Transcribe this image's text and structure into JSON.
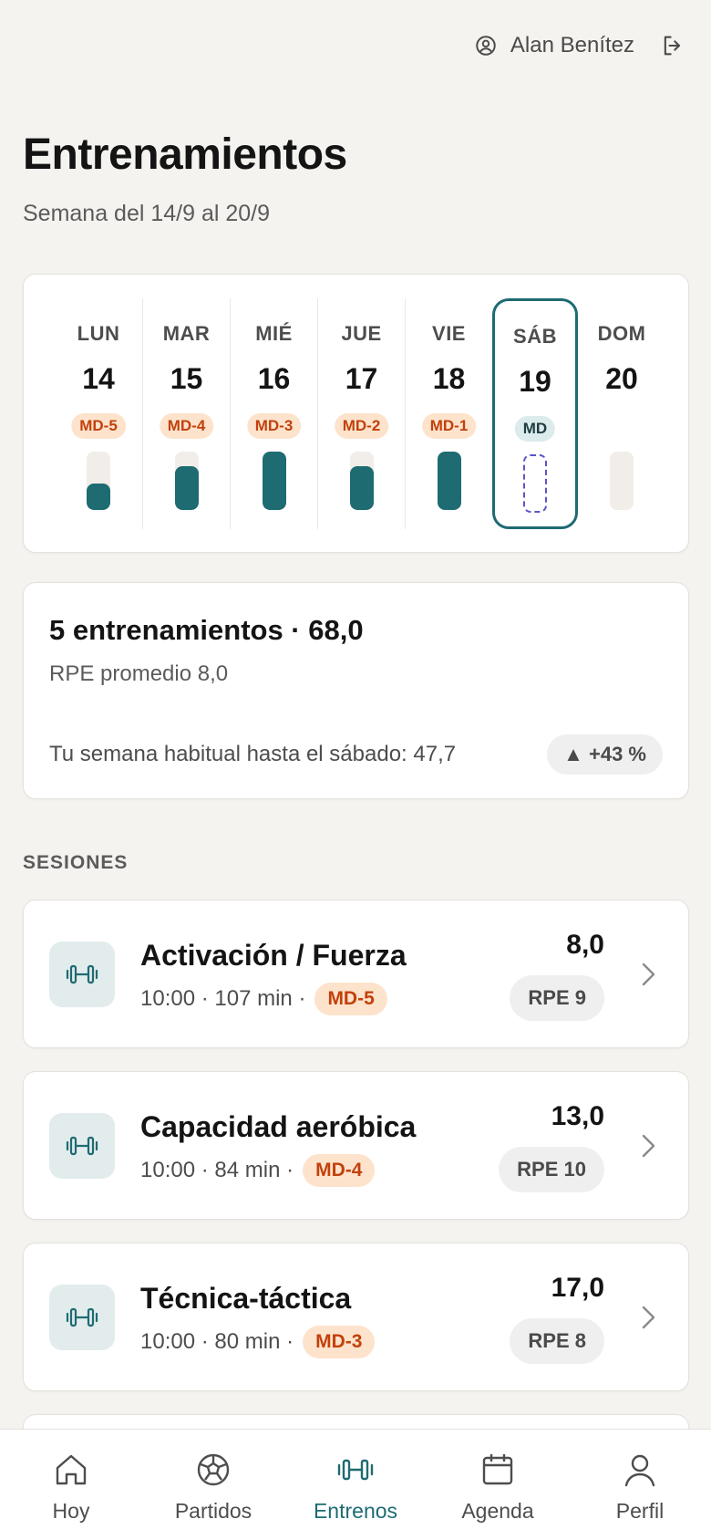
{
  "header": {
    "user_name": "Alan Benítez",
    "user_icon": "user-circle-icon",
    "logout_icon": "logout-icon"
  },
  "page": {
    "title": "Entrenamientos",
    "week_range": "Semana del 14/9 al 20/9"
  },
  "week": {
    "days": [
      {
        "name": "LUN",
        "num": "14",
        "md": "MD-5",
        "load": 0.45,
        "state": "done"
      },
      {
        "name": "MAR",
        "num": "15",
        "md": "MD-4",
        "load": 0.75,
        "state": "done"
      },
      {
        "name": "MIÉ",
        "num": "16",
        "md": "MD-3",
        "load": 1.0,
        "state": "done"
      },
      {
        "name": "JUE",
        "num": "17",
        "md": "MD-2",
        "load": 0.75,
        "state": "done"
      },
      {
        "name": "VIE",
        "num": "18",
        "md": "MD-1",
        "load": 1.0,
        "state": "done"
      },
      {
        "name": "SÁB",
        "num": "19",
        "md": "MD",
        "load": 0,
        "state": "selected"
      },
      {
        "name": "DOM",
        "num": "20",
        "md": "",
        "load": 0,
        "state": "empty"
      }
    ]
  },
  "summary": {
    "title": "5 entrenamientos · 68,0",
    "rpe_avg": "RPE promedio 8,0",
    "habit": "Tu semana habitual hasta el sábado: 47,7",
    "trend": "▲ +43 %"
  },
  "sessions_label": "SESIONES",
  "sessions": [
    {
      "name": "Activación / Fuerza",
      "meta": "10:00 · 107 min ·",
      "md": "MD-5",
      "load": "8,0",
      "rpe": "RPE 9"
    },
    {
      "name": "Capacidad aeróbica",
      "meta": "10:00 · 84 min ·",
      "md": "MD-4",
      "load": "13,0",
      "rpe": "RPE 10"
    },
    {
      "name": "Técnica-táctica",
      "meta": "10:00 · 80 min ·",
      "md": "MD-3",
      "load": "17,0",
      "rpe": "RPE 8"
    }
  ],
  "nav": {
    "items": [
      {
        "label": "Hoy",
        "icon": "home-icon"
      },
      {
        "label": "Partidos",
        "icon": "soccer-ball-icon"
      },
      {
        "label": "Entrenos",
        "icon": "dumbbell-icon",
        "active": true
      },
      {
        "label": "Agenda",
        "icon": "calendar-icon"
      },
      {
        "label": "Perfil",
        "icon": "user-icon"
      }
    ]
  },
  "colors": {
    "accent": "#1e6b72",
    "md_badge_bg": "#fde3cc",
    "md_badge_text": "#c2410c"
  }
}
